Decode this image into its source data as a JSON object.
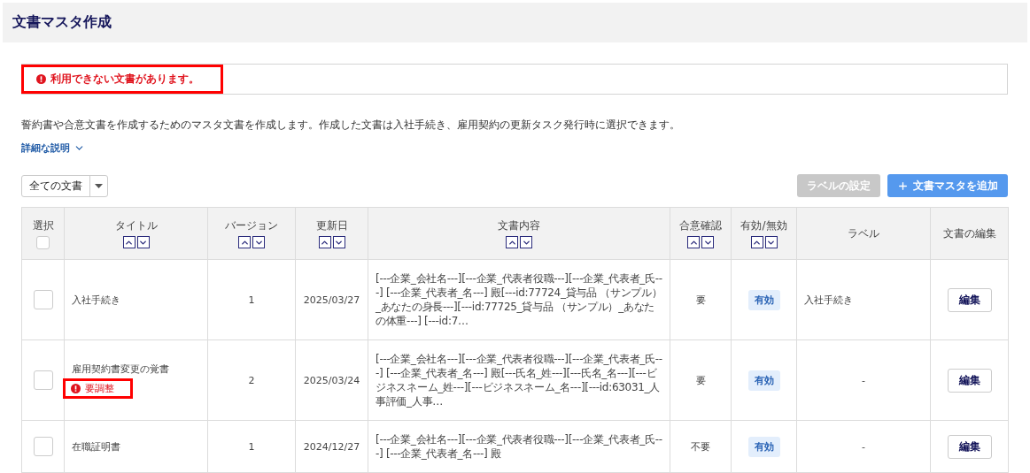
{
  "page": {
    "title": "文書マスタ作成"
  },
  "alert": {
    "message": "利用できない文書があります。",
    "highlighted": true
  },
  "description": "誓約書や合意文書を作成するためのマスタ文書を作成します。作成した文書は入社手続き、雇用契約の更新タスク発行時に選択できます。",
  "details_link": {
    "label": "詳細な説明",
    "expanded": false
  },
  "filter": {
    "value": "全ての文書"
  },
  "buttons": [
    {
      "label": "ラベルの設定",
      "kind": "secondary",
      "disabled": true
    },
    {
      "label": "文書マスタを追加",
      "kind": "add",
      "disabled": false
    }
  ],
  "table": {
    "select_all": {
      "checked": false
    },
    "columns": [
      {
        "label": "選択",
        "kind": "select",
        "sortable": false
      },
      {
        "label": "タイトル",
        "kind": "title",
        "sortable": true
      },
      {
        "label": "バージョン",
        "kind": "version",
        "sortable": true
      },
      {
        "label": "更新日",
        "kind": "date",
        "sortable": true
      },
      {
        "label": "文書内容",
        "kind": "content",
        "sortable": true
      },
      {
        "label": "合意確認",
        "kind": "consent",
        "sortable": true
      },
      {
        "label": "有効/無効",
        "kind": "status",
        "sortable": true
      },
      {
        "label": "ラベル",
        "kind": "label",
        "sortable": false
      },
      {
        "label": "文書の編集",
        "kind": "edit",
        "sortable": false
      }
    ],
    "rows": [
      {
        "checked": false,
        "title": "入社手続き",
        "version": "1",
        "date": "2025/03/27",
        "content": "[---企業_会社名---][---企業_代表者役職---][---企業_代表者_氏---] [---企業_代表者_名---] 殿[---id:77724_貸与品 （サンプル）_あなたの身長---][---id:77725_貸与品 （サンプル）_あなたの体重---] [---id:7…",
        "consent": "要",
        "status": {
          "label": "有効",
          "on": true
        },
        "label": "入社手続き",
        "edit": "編集"
      },
      {
        "checked": false,
        "title": "雇用契約書変更の覚書",
        "warning": {
          "text": "要調整",
          "highlighted": true
        },
        "version": "2",
        "date": "2025/03/24",
        "content": "[---企業_会社名---][---企業_代表者役職---][---企業_代表者_氏---] [---企業_代表者_名---] 殿[---氏名_姓---][---氏名_名---][---ビジネスネーム_姓---][---ビジネスネーム_名---][---id:63031_人事評価_人事…",
        "consent": "要",
        "status": {
          "label": "有効",
          "on": true
        },
        "label": "-",
        "edit": "編集"
      },
      {
        "checked": false,
        "title": "在職証明書",
        "version": "1",
        "date": "2024/12/27",
        "content": "[---企業_会社名---][---企業_代表者役職---][---企業_代表者_氏---] [---企業_代表者_名---] 殿",
        "consent": "不要",
        "status": {
          "label": "有効",
          "on": true
        },
        "label": "-",
        "edit": "編集"
      }
    ]
  }
}
